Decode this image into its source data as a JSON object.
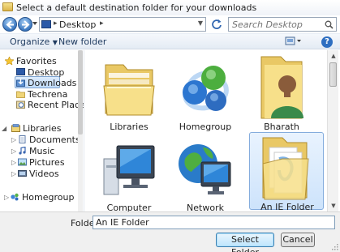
{
  "window": {
    "title": "Select a default destination folder for your downloads"
  },
  "address": {
    "location": "Desktop",
    "search_placeholder": "Search Desktop"
  },
  "toolbar": {
    "organize_label": "Organize",
    "new_folder_label": "New folder"
  },
  "sidebar": {
    "favorites_header": "Favorites",
    "favorites": [
      {
        "label": "Desktop",
        "icon": "desktop-icon"
      },
      {
        "label": "Downloads",
        "icon": "downloads-icon",
        "selected": true
      },
      {
        "label": "Techrena",
        "icon": "folder-icon"
      },
      {
        "label": "Recent Places",
        "icon": "recent-places-icon"
      }
    ],
    "libraries_header": "Libraries",
    "libraries": [
      {
        "label": "Documents",
        "icon": "documents-icon"
      },
      {
        "label": "Music",
        "icon": "music-icon"
      },
      {
        "label": "Pictures",
        "icon": "pictures-icon"
      },
      {
        "label": "Videos",
        "icon": "videos-icon"
      }
    ],
    "homegroup_header": "Homegroup"
  },
  "items": [
    {
      "label": "Libraries",
      "icon": "libraries-icon"
    },
    {
      "label": "Homegroup",
      "icon": "homegroup-icon"
    },
    {
      "label": "Bharath",
      "icon": "user-folder-icon"
    },
    {
      "label": "Computer",
      "icon": "computer-icon"
    },
    {
      "label": "Network",
      "icon": "network-icon"
    },
    {
      "label": "An IE Folder",
      "icon": "folder-icon",
      "selected": true
    }
  ],
  "footer": {
    "folder_label": "Folder:",
    "folder_value": "An IE Folder",
    "select_button": "Select Folder",
    "cancel_button": "Cancel"
  },
  "colors": {
    "accent": "#3c7fb1",
    "selection": "#cde3fb",
    "toolbar_text": "#1e3a5f"
  }
}
